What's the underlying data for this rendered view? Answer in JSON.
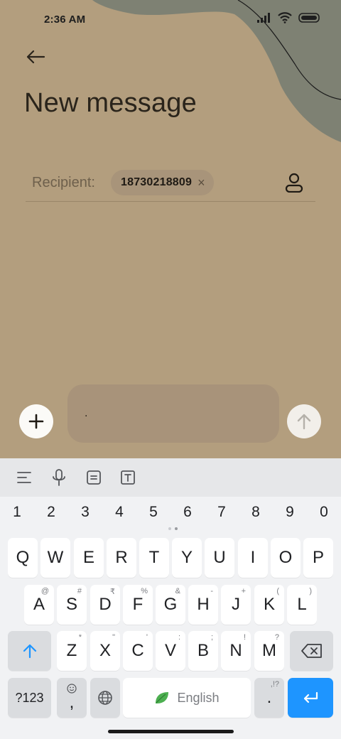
{
  "status": {
    "time": "2:36 AM"
  },
  "header": {
    "title": "New message"
  },
  "recipient": {
    "label": "Recipient:",
    "chip": "18730218809",
    "chip_remove": "×"
  },
  "compose": {
    "message_value": "."
  },
  "keyboard": {
    "numbers": [
      "1",
      "2",
      "3",
      "4",
      "5",
      "6",
      "7",
      "8",
      "9",
      "0"
    ],
    "row1": [
      {
        "k": "Q",
        "h": ""
      },
      {
        "k": "W",
        "h": ""
      },
      {
        "k": "E",
        "h": ""
      },
      {
        "k": "R",
        "h": ""
      },
      {
        "k": "T",
        "h": ""
      },
      {
        "k": "Y",
        "h": ""
      },
      {
        "k": "U",
        "h": ""
      },
      {
        "k": "I",
        "h": ""
      },
      {
        "k": "O",
        "h": ""
      },
      {
        "k": "P",
        "h": ""
      }
    ],
    "row2": [
      {
        "k": "A",
        "h": "@"
      },
      {
        "k": "S",
        "h": "#"
      },
      {
        "k": "D",
        "h": "₹"
      },
      {
        "k": "F",
        "h": "%"
      },
      {
        "k": "G",
        "h": "&"
      },
      {
        "k": "H",
        "h": "-"
      },
      {
        "k": "J",
        "h": "+"
      },
      {
        "k": "K",
        "h": "("
      },
      {
        "k": "L",
        "h": ")"
      }
    ],
    "row3": [
      {
        "k": "Z",
        "h": "*"
      },
      {
        "k": "X",
        "h": "\""
      },
      {
        "k": "C",
        "h": "'"
      },
      {
        "k": "V",
        "h": ":"
      },
      {
        "k": "B",
        "h": ";"
      },
      {
        "k": "N",
        "h": "!"
      },
      {
        "k": "M",
        "h": "?"
      }
    ],
    "symbols_label": "?123",
    "comma": ",",
    "space_label": "English",
    "period": ".",
    "period_hint": ",!?"
  },
  "colors": {
    "app_background": "#b39e7e",
    "accent_blob": "#7e8173",
    "enter_key": "#1e95ff",
    "shift_arrow": "#1e95ff",
    "leaf_icon": "#4caf50"
  },
  "icons": {
    "back": "arrow-left-icon",
    "contact": "person-icon",
    "attach": "plus-icon",
    "send": "arrow-up-icon",
    "toolbar": [
      "menu-lines-icon",
      "microphone-icon",
      "clipboard-icon",
      "text-box-icon"
    ],
    "shift": "arrow-up-icon",
    "backspace": "backspace-icon",
    "emoji": "smiley-icon",
    "language": "globe-icon",
    "space_logo": "leaf-icon",
    "enter": "return-arrow-icon"
  }
}
